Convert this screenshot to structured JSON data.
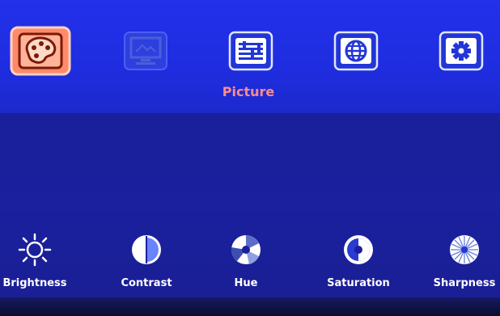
{
  "categories": [
    {
      "name": "picture",
      "icon": "palette-icon",
      "active": true
    },
    {
      "name": "display",
      "icon": "monitor-icon",
      "active": false
    },
    {
      "name": "adjust",
      "icon": "equalizer-icon",
      "active": false
    },
    {
      "name": "network",
      "icon": "globe-icon",
      "active": false
    },
    {
      "name": "settings",
      "icon": "gear-icon",
      "active": false
    }
  ],
  "active_category_label": "Picture",
  "items": [
    {
      "label": "Brightness",
      "icon": "sun-icon"
    },
    {
      "label": "Contrast",
      "icon": "contrast-icon"
    },
    {
      "label": "Hue",
      "icon": "hue-icon"
    },
    {
      "label": "Saturation",
      "icon": "saturation-icon"
    },
    {
      "label": "Sharpness",
      "icon": "sharpness-icon"
    }
  ],
  "colors": {
    "active_tile": "#ff8a6a",
    "active_label": "#ff8c8c",
    "top_band": "#2231ea",
    "bottom_band": "#1a1f9a",
    "text": "#ffffff"
  }
}
